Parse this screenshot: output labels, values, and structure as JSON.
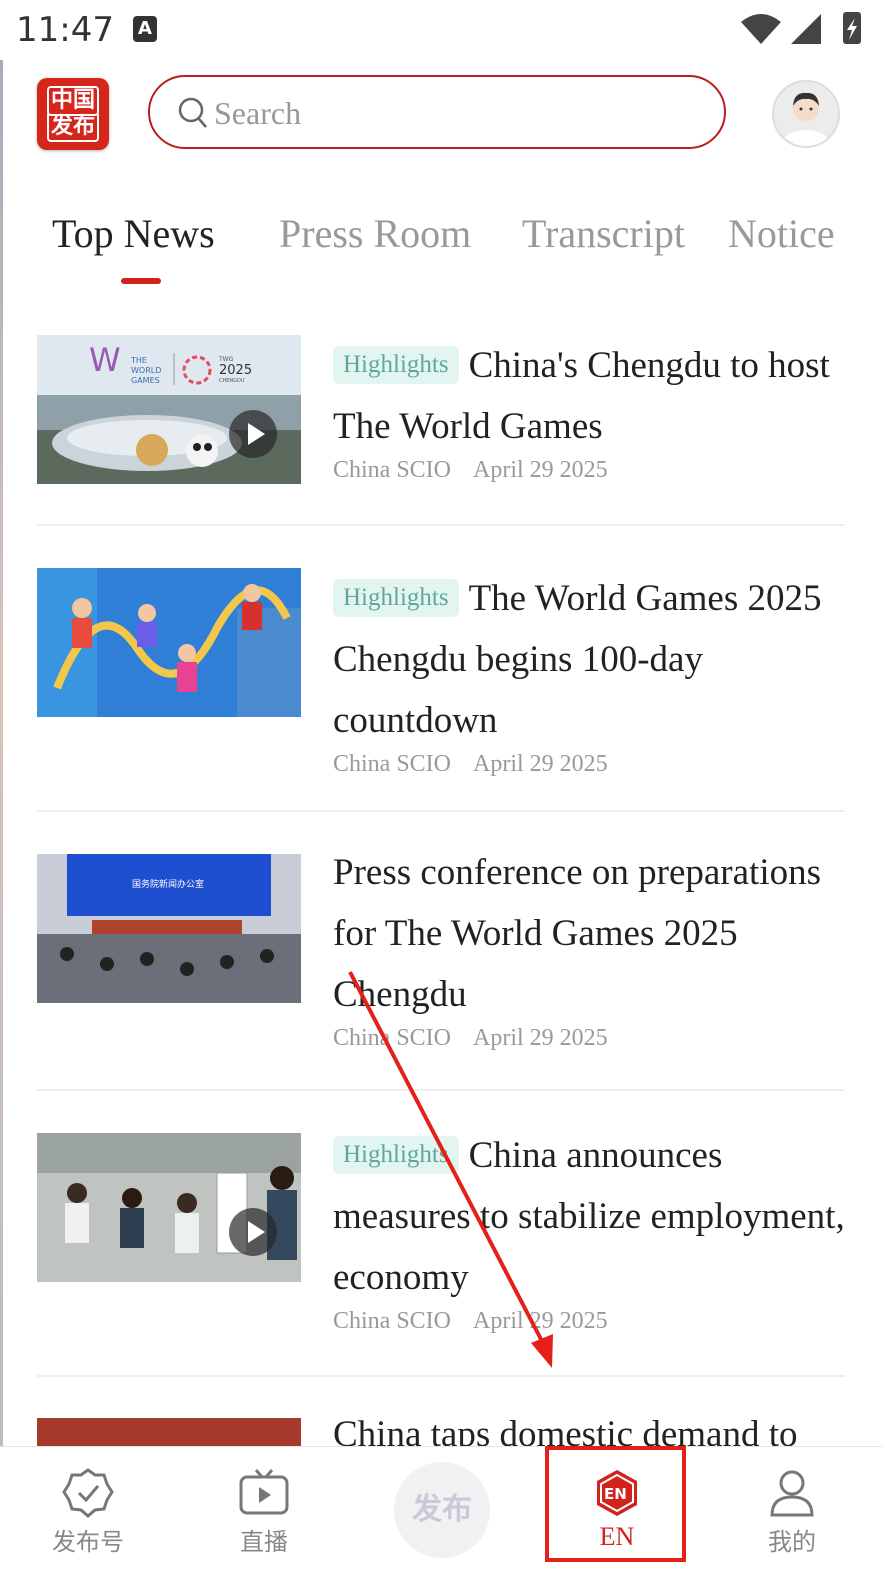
{
  "status_bar": {
    "time": "11:47",
    "a_label": "A"
  },
  "header": {
    "logo_line1": "中国",
    "logo_line2": "发布",
    "search_placeholder": "Search"
  },
  "tabs": [
    {
      "label": "Top News",
      "active": true
    },
    {
      "label": "Press Room",
      "active": false
    },
    {
      "label": "Transcript",
      "active": false
    },
    {
      "label": "Notice",
      "active": false
    }
  ],
  "news": [
    {
      "badge": "Highlights",
      "title": "China's Chengdu to host The World Games",
      "source": "China SCIO",
      "date": "April 29 2025",
      "video": true
    },
    {
      "badge": "Highlights",
      "title": "The World Games 2025 Chengdu begins 100-day countdown",
      "source": "China SCIO",
      "date": "April 29 2025",
      "video": false
    },
    {
      "badge": "",
      "title": "Press conference on preparations for The World Games 2025 Chengdu",
      "source": "China SCIO",
      "date": "April 29 2025",
      "video": false
    },
    {
      "badge": "Highlights",
      "title": "China announces measures to stabilize employment, economy",
      "source": "China SCIO",
      "date": "April 29 2025",
      "video": true
    },
    {
      "badge": "",
      "title": "China taps domestic demand to",
      "source": "",
      "date": "",
      "video": false
    }
  ],
  "thumb_text": {
    "wg_line1": "THE",
    "wg_line2": "WORLD",
    "wg_line3": "GAMES",
    "twg_label": "TWG",
    "twg_year": "2025",
    "twg_city": "CHENGDU",
    "press_banner": "国务院新闻办公室"
  },
  "bottom_nav": [
    {
      "label": "发布号",
      "icon": "badge-check-icon"
    },
    {
      "label": "直播",
      "icon": "tv-play-icon"
    },
    {
      "label": "发布",
      "icon": "publish-center-icon"
    },
    {
      "label": "EN",
      "icon": "en-hexagon-icon",
      "active": true
    },
    {
      "label": "我的",
      "icon": "user-icon"
    }
  ],
  "colors": {
    "accent": "#d2221c",
    "badge_bg": "#e3f5f0",
    "badge_text": "#5fa899"
  }
}
